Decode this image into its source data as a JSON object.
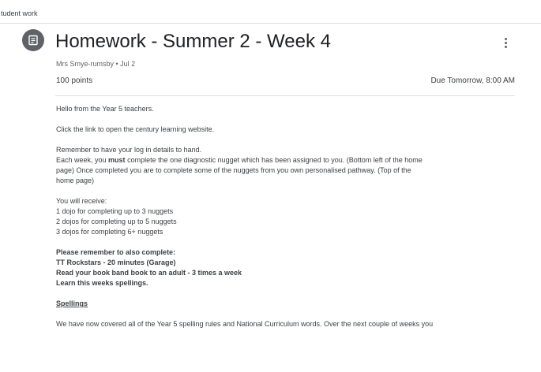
{
  "tab": {
    "label": "tudent work"
  },
  "header": {
    "title": "Homework - Summer 2 - Week 4",
    "meta": "Mrs Smye-rumsby • Jul 2",
    "points": "100 points",
    "due": "Due Tomorrow, 8:00 AM"
  },
  "body": {
    "greeting": "Hello from the Year 5 teachers.",
    "link_instruction": "Click the link to open the century learning website.",
    "remember": "Remember to have your log in details to hand.",
    "each_week_pre": "Each week, you ",
    "each_week_bold": "must",
    "each_week_post_1": " complete the one diagnostic nugget which has been assigned to you. (Bottom left of the home",
    "each_week_post_2": "page) Once completed you are to complete some of the nuggets from you own personalised pathway. (Top of the",
    "each_week_post_3": "home page)",
    "receive_heading": "You will receive:",
    "receive_items": [
      "1 dojo for completing up to 3 nuggets",
      "2 dojos for completing up to 5 nuggets",
      "3 dojos for completing 6+ nuggets"
    ],
    "also_heading": "Please remember to also complete:",
    "also_items": [
      "TT  Rockstars - 20 minutes (Garage)",
      "Read your book band book to an adult - 3 times a week",
      "Learn this weeks spellings."
    ],
    "spellings_heading": "Spellings",
    "spellings_text": "We have now covered all of the Year 5 spelling rules and National Curriculum words. Over the next couple of weeks you"
  }
}
